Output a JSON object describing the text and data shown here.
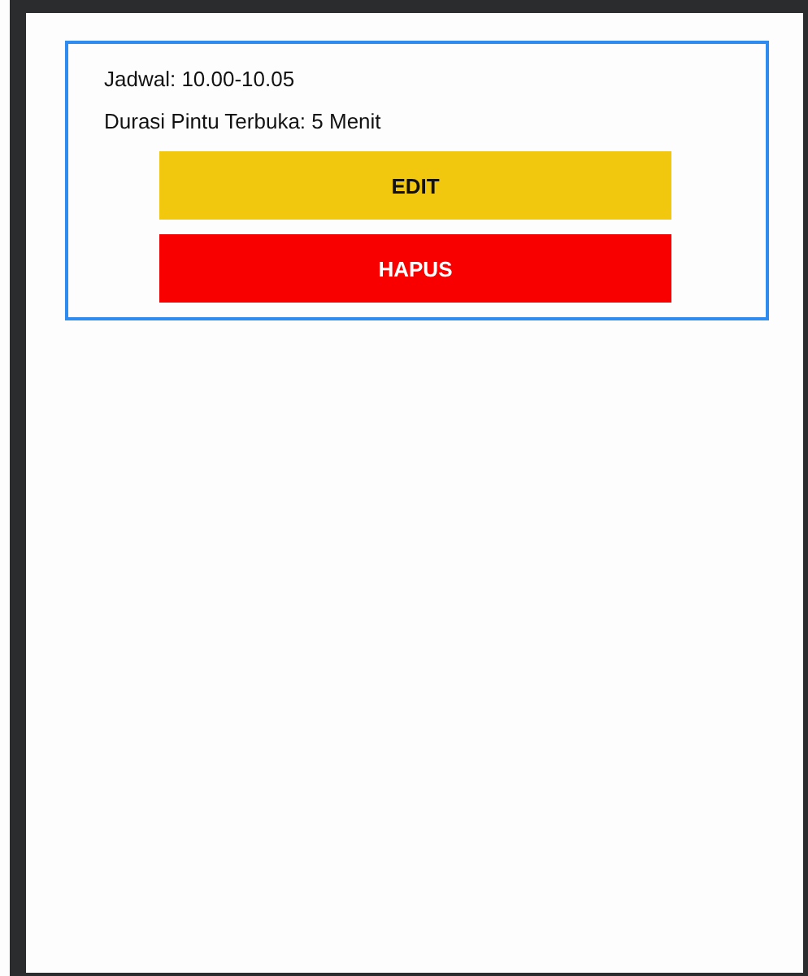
{
  "schedule": {
    "lines": [
      "Jadwal: 10.00-10.05",
      "Durasi Pintu Terbuka: 5 Menit"
    ],
    "buttons": [
      {
        "label": "EDIT",
        "kind": "edit"
      },
      {
        "label": "HAPUS",
        "kind": "delete"
      }
    ]
  }
}
